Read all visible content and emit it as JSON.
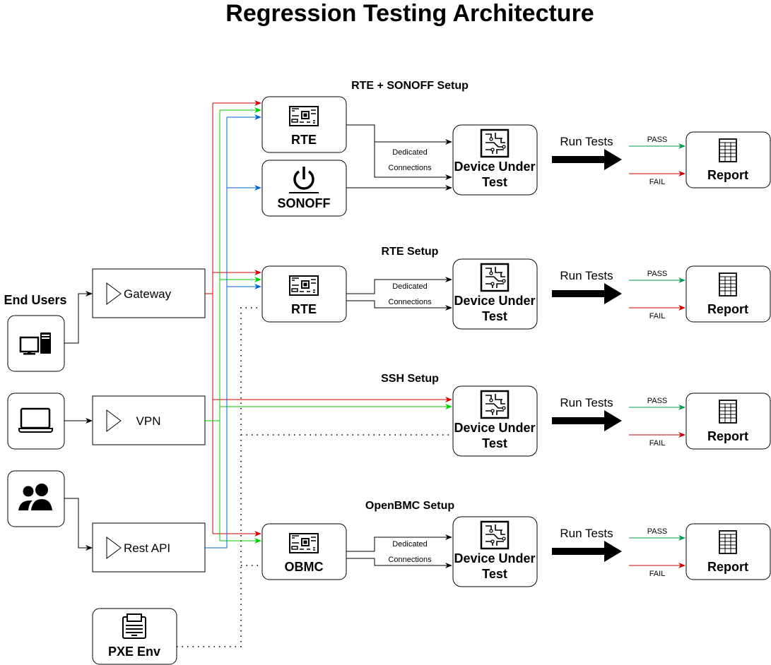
{
  "title": "Regression Testing Architecture",
  "end_users": {
    "label": "End Users",
    "items": [
      {
        "icon": "desktop-computer-icon"
      },
      {
        "icon": "laptop-icon"
      },
      {
        "icon": "users-group-icon"
      }
    ]
  },
  "access": {
    "gateway": "Gateway",
    "vpn": "VPN",
    "rest_api": "Rest API"
  },
  "pxe": {
    "label": "PXE Env",
    "icon": "server-icon"
  },
  "setups": [
    {
      "heading": "RTE + SONOFF Setup",
      "controller": "RTE",
      "extra": "SONOFF",
      "link_label_1": "Dedicated",
      "link_label_2": "Connections"
    },
    {
      "heading": "RTE Setup",
      "controller": "RTE",
      "link_label_1": "Dedicated",
      "link_label_2": "Connections"
    },
    {
      "heading": "SSH Setup"
    },
    {
      "heading": "OpenBMC Setup",
      "controller": "OBMC",
      "link_label_1": "Dedicated",
      "link_label_2": "Connections"
    }
  ],
  "dut": {
    "line1": "Device Under",
    "line2": "Test"
  },
  "run_tests": "Run Tests",
  "pass": "PASS",
  "fail": "FAIL",
  "report": "Report",
  "colors": {
    "gateway_line": "#CC0000",
    "vpn_line": "#00CC00",
    "rest_api_line": "#0066CC",
    "pass": "#00994D",
    "fail": "#CC0000"
  }
}
